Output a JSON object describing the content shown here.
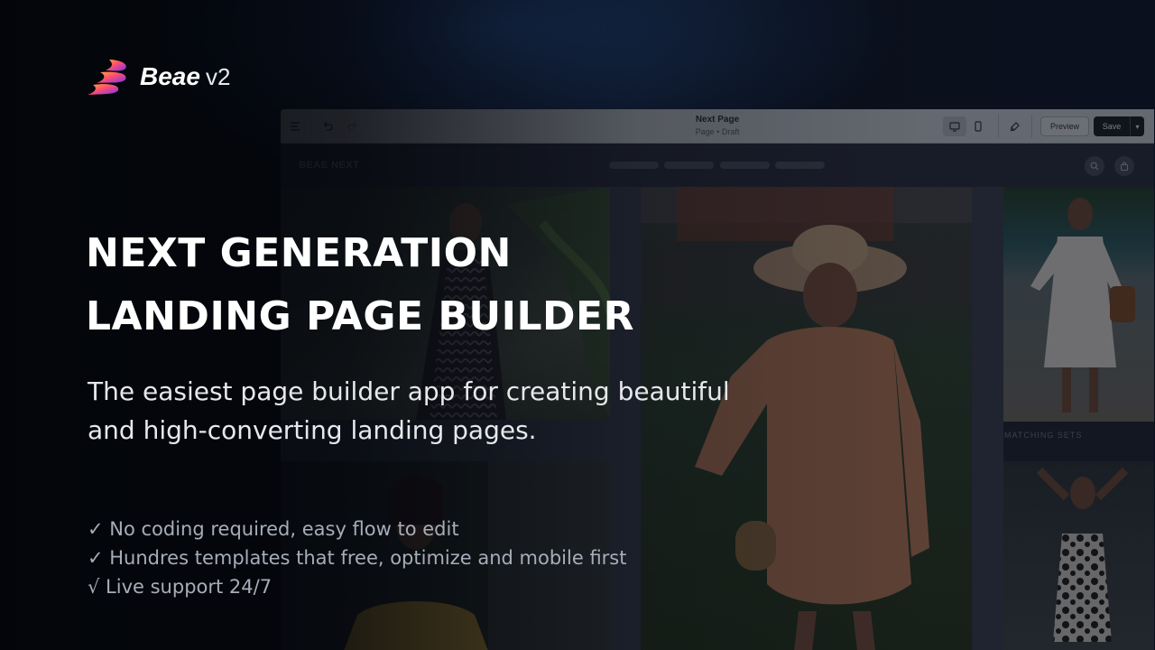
{
  "brand": {
    "logo_icon": "beae-flame-logo",
    "name": "Beae",
    "version": "v2"
  },
  "hero": {
    "headline_line1": "NEXT GENERATION",
    "headline_line2": "LANDING PAGE BUILDER",
    "subtitle_line1": "The easiest page builder app for creating beautiful",
    "subtitle_line2": "and high-converting landing pages."
  },
  "features": [
    "✓ No coding required, easy flow to edit",
    "✓ Hundres templates that free, optimize and mobile first",
    "√ Live support 24/7"
  ],
  "builder": {
    "page_title": "Next Page",
    "page_status": "Page • Draft",
    "preview_label": "Preview",
    "save_label": "Save",
    "icons": {
      "menu": "hamburger-icon",
      "undo": "undo-icon",
      "redo": "redo-icon",
      "desktop": "desktop-icon",
      "mobile": "mobile-icon",
      "style": "brush-icon",
      "save_menu": "chevron-down-icon"
    }
  },
  "store": {
    "brand": "BEAE NEXT",
    "caption_matching": "MATCHING SETS",
    "icons": {
      "search": "search-icon",
      "cart": "bag-icon"
    }
  },
  "colors": {
    "background": "#05070d",
    "logo_gradient_start": "#ff5a5f",
    "logo_gradient_end": "#7b2ff7",
    "save_button": "#1b1f26"
  }
}
